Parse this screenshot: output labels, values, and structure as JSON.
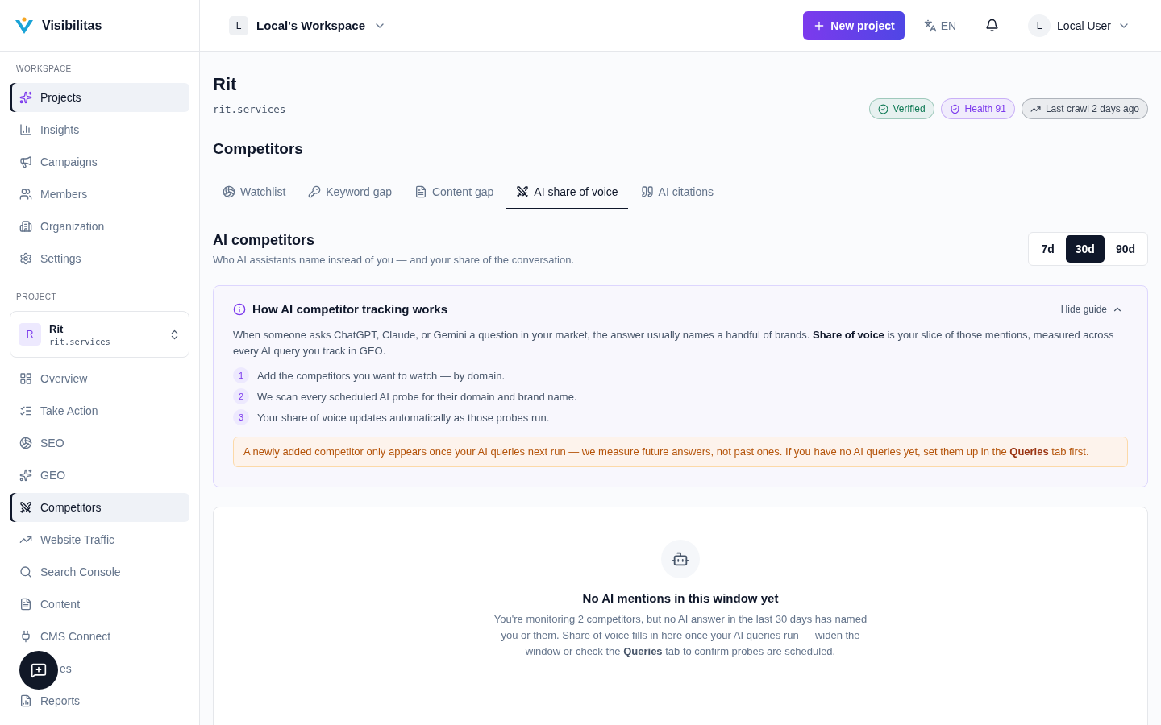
{
  "brand": {
    "name": "Visibilitas"
  },
  "workspace": {
    "avatar": "L",
    "name": "Local's Workspace"
  },
  "header": {
    "new_project": "New project",
    "language": "EN",
    "user": {
      "avatar": "L",
      "name": "Local User"
    }
  },
  "sidebar": {
    "workspace_heading": "WORKSPACE",
    "workspace_items": [
      {
        "label": "Projects",
        "selected": true
      },
      {
        "label": "Insights",
        "selected": false
      },
      {
        "label": "Campaigns",
        "selected": false
      },
      {
        "label": "Members",
        "selected": false
      },
      {
        "label": "Organization",
        "selected": false
      },
      {
        "label": "Settings",
        "selected": false
      }
    ],
    "project_heading": "PROJECT",
    "project_switcher": {
      "avatar": "R",
      "name": "Rit",
      "domain": "rit.services"
    },
    "project_items": [
      {
        "label": "Overview",
        "selected": false,
        "kind": "link"
      },
      {
        "label": "Take Action",
        "selected": false,
        "kind": "link"
      },
      {
        "label": "SEO",
        "selected": false,
        "kind": "link"
      },
      {
        "label": "GEO",
        "selected": false,
        "kind": "link"
      },
      {
        "label": "Competitors",
        "selected": true,
        "kind": "link"
      },
      {
        "label": "Website Traffic",
        "selected": false,
        "kind": "link"
      },
      {
        "label": "Search Console",
        "selected": false,
        "kind": "link"
      },
      {
        "label": "Content",
        "selected": false,
        "kind": "link"
      },
      {
        "label": "CMS Connect",
        "selected": false,
        "kind": "link"
      },
      {
        "label": "es",
        "selected": false,
        "kind": "covered"
      },
      {
        "label": "Reports",
        "selected": false,
        "kind": "link"
      }
    ]
  },
  "project": {
    "title": "Rit",
    "domain": "rit.services",
    "badges": [
      {
        "label": "Verified",
        "color": "#0f7a55"
      },
      {
        "label": "Health 91",
        "color": "#7c3aed"
      },
      {
        "label": "Last crawl 2 days ago",
        "color": "#374151"
      }
    ]
  },
  "section_title": "Competitors",
  "tabs": [
    {
      "label": "Watchlist",
      "selected": false
    },
    {
      "label": "Keyword gap",
      "selected": false
    },
    {
      "label": "Content gap",
      "selected": false
    },
    {
      "label": "AI share of voice",
      "selected": true
    },
    {
      "label": "AI citations",
      "selected": false
    }
  ],
  "panel": {
    "title": "AI competitors",
    "subtitle": "Who AI assistants name instead of you — and your share of the conversation.",
    "ranges": [
      {
        "label": "7d",
        "selected": false
      },
      {
        "label": "30d",
        "selected": true
      },
      {
        "label": "90d",
        "selected": false
      }
    ]
  },
  "guide": {
    "title": "How AI competitor tracking works",
    "toggle": "Hide guide",
    "expanded": true,
    "intro": "When someone asks ChatGPT, Claude, or Gemini a question in your market, the answer usually names a handful of brands. **Share of voice** is your slice of those mentions, measured across every AI query you track in GEO.",
    "steps": [
      {
        "number": "1",
        "text": "Add the competitors you want to watch — by domain."
      },
      {
        "number": "2",
        "text": "We scan every scheduled AI probe for their domain and brand name."
      },
      {
        "number": "3",
        "text": "Your share of voice updates automatically as those probes run."
      }
    ],
    "note": "A newly added competitor only appears once your AI queries next run — we measure future answers, not past ones. If you have no AI queries yet, set them up in the **Queries** tab first."
  },
  "empty": {
    "title": "No AI mentions in this window yet",
    "text": "You're monitoring 2 competitors, but no AI answer in the last 30 days has named you or them. Share of voice fills in here once your AI queries run — widen the window or check the **Queries** tab to confirm probes are scheduled."
  }
}
